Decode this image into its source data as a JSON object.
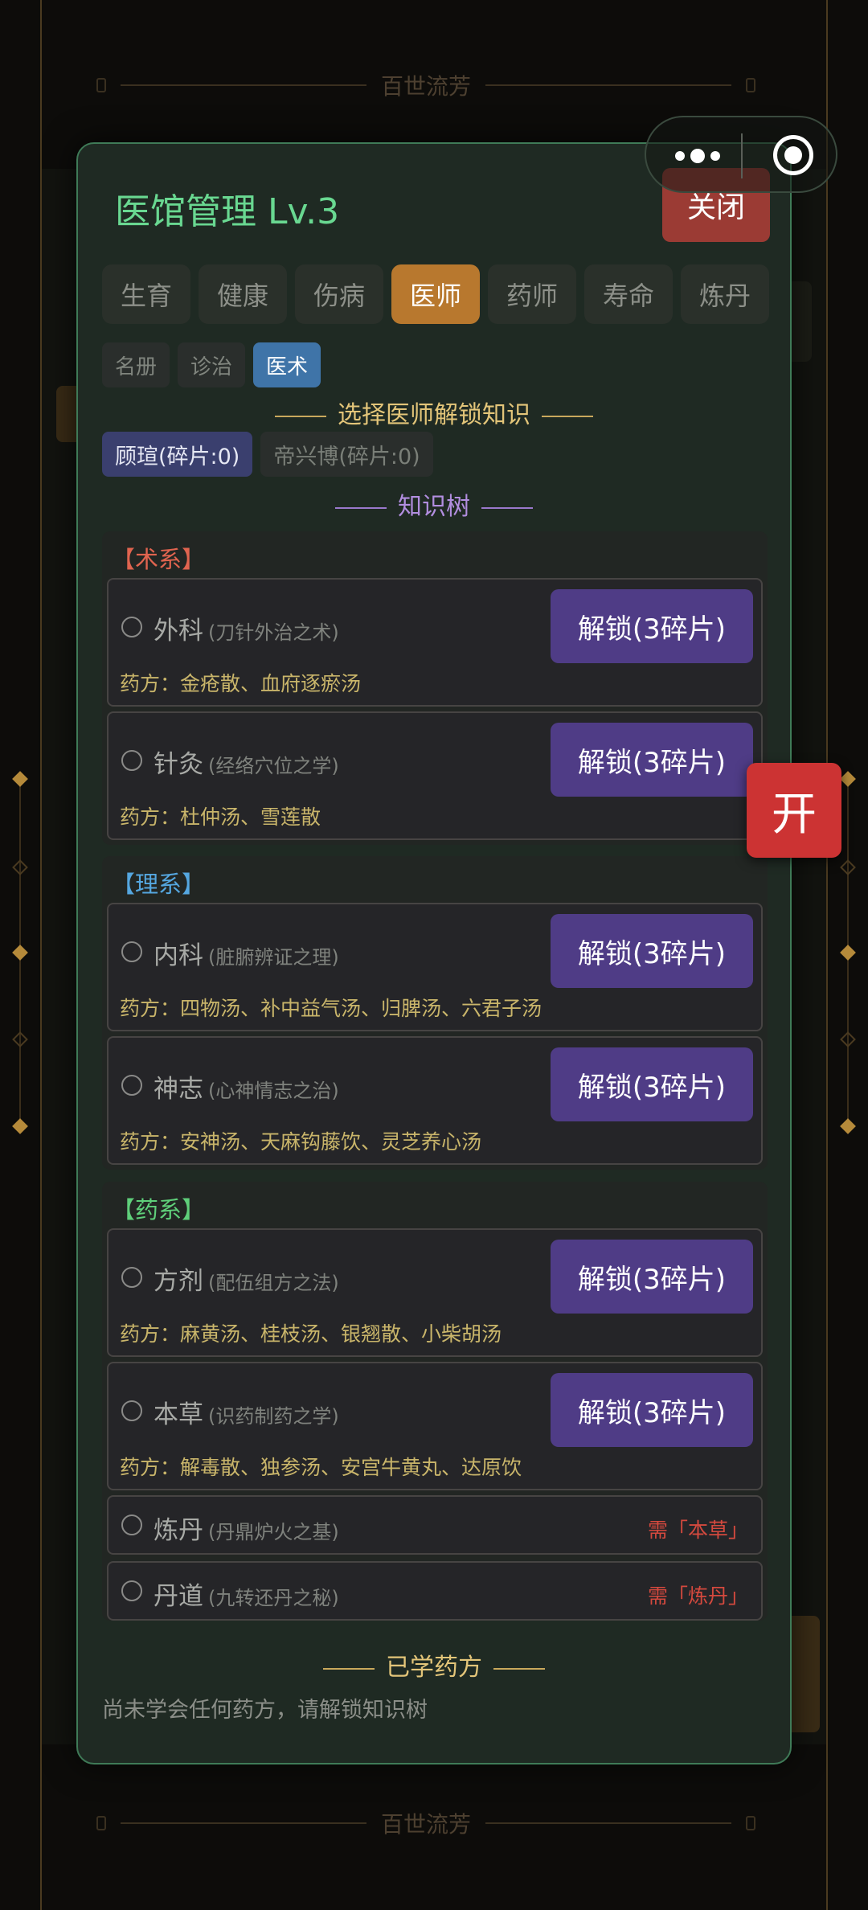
{
  "banner": {
    "top_text": "百世流芳",
    "bottom_text": "百世流芳"
  },
  "modal": {
    "title": "医馆管理 Lv.3",
    "close_label": "关闭",
    "tabs": [
      {
        "label": "生育",
        "active": false
      },
      {
        "label": "健康",
        "active": false
      },
      {
        "label": "伤病",
        "active": false
      },
      {
        "label": "医师",
        "active": true
      },
      {
        "label": "药师",
        "active": false
      },
      {
        "label": "寿命",
        "active": false
      },
      {
        "label": "炼丹",
        "active": false
      }
    ],
    "subtabs": [
      {
        "label": "名册",
        "active": false
      },
      {
        "label": "诊治",
        "active": false
      },
      {
        "label": "医术",
        "active": true
      }
    ],
    "select_heading": "选择医师解锁知识",
    "doctors": [
      {
        "label": "顾瑄(碎片:0)",
        "active": true
      },
      {
        "label": "帝兴博(碎片:0)",
        "active": false
      }
    ],
    "tree_heading": "知识树",
    "groups": [
      {
        "title": "【术系】",
        "color": "#e0644f",
        "skills": [
          {
            "name": "外科",
            "desc": "(刀针外治之术)",
            "recipe": "药方：金疮散、血府逐瘀汤",
            "unlock": "解锁(3碎片)"
          },
          {
            "name": "针灸",
            "desc": "(经络穴位之学)",
            "recipe": "药方：杜仲汤、雪莲散",
            "unlock": "解锁(3碎片)"
          }
        ]
      },
      {
        "title": "【理系】",
        "color": "#55a7e0",
        "skills": [
          {
            "name": "内科",
            "desc": "(脏腑辨证之理)",
            "recipe": "药方：四物汤、补中益气汤、归脾汤、六君子汤",
            "unlock": "解锁(3碎片)"
          },
          {
            "name": "神志",
            "desc": "(心神情志之治)",
            "recipe": "药方：安神汤、天麻钩藤饮、灵芝养心汤",
            "unlock": "解锁(3碎片)"
          }
        ]
      },
      {
        "title": "【药系】",
        "color": "#5fcf7a",
        "skills": [
          {
            "name": "方剂",
            "desc": "(配伍组方之法)",
            "recipe": "药方：麻黄汤、桂枝汤、银翘散、小柴胡汤",
            "unlock": "解锁(3碎片)"
          },
          {
            "name": "本草",
            "desc": "(识药制药之学)",
            "recipe": "药方：解毒散、独参汤、安宫牛黄丸、达原饮",
            "unlock": "解锁(3碎片)"
          }
        ],
        "locked": [
          {
            "name": "炼丹",
            "desc": "(丹鼎炉火之基)",
            "requirement": "需「本草」"
          },
          {
            "name": "丹道",
            "desc": "(九转还丹之秘)",
            "requirement": "需「炼丹」"
          }
        ]
      }
    ],
    "learned_heading": "已学药方",
    "learned_empty": "尚未学会任何药方，请解锁知识树"
  },
  "floating": {
    "open_label": "开"
  },
  "colors": {
    "accent_green": "#69d891",
    "unlock_purple": "#4f3c86",
    "active_tab": "#b8782e",
    "close_red": "#9b3b34"
  }
}
